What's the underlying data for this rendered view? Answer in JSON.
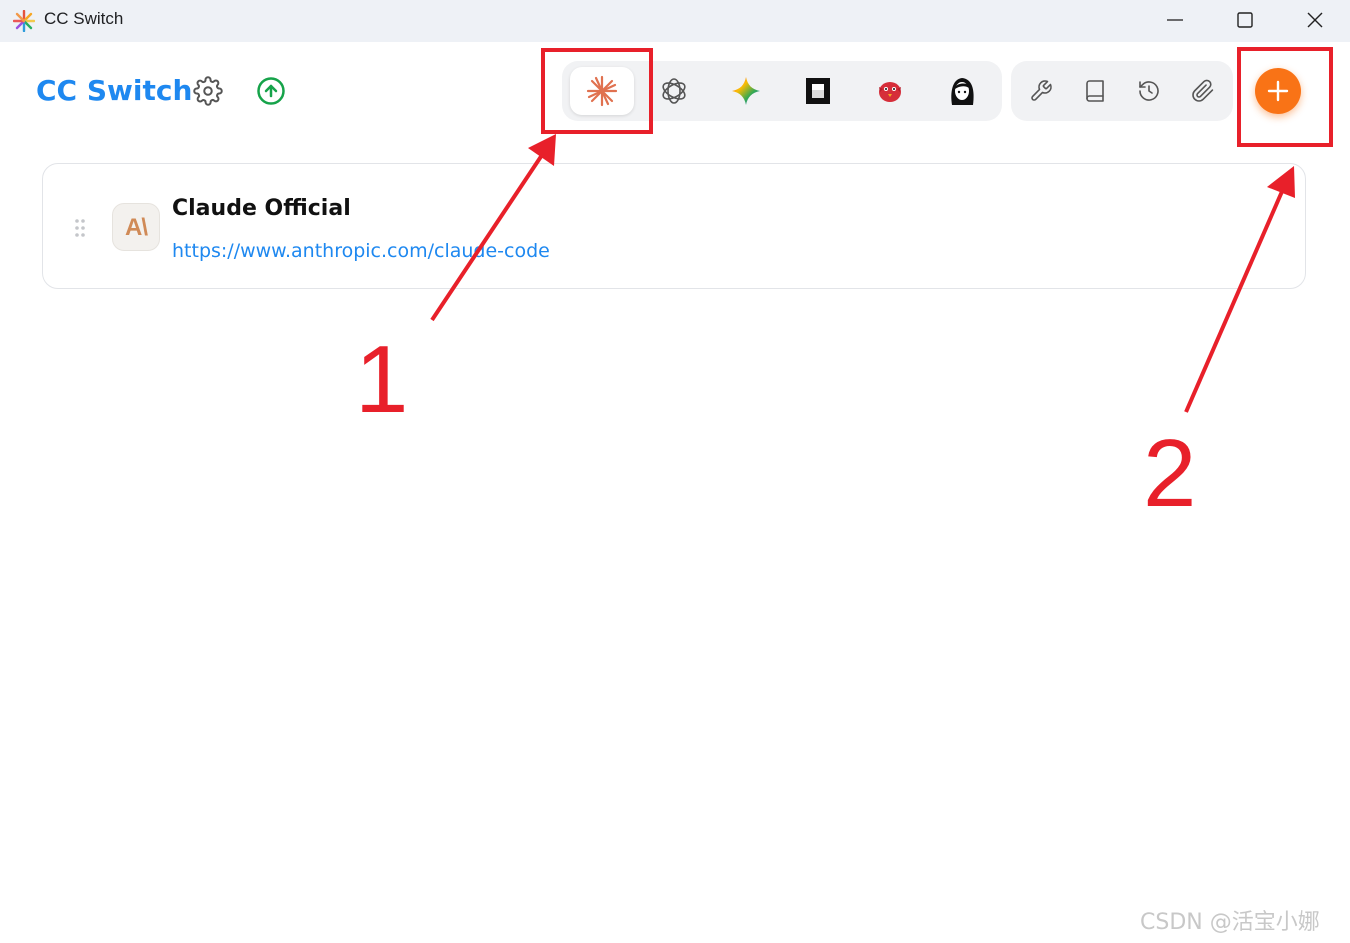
{
  "window": {
    "title": "CC Switch",
    "controls": [
      "minimize",
      "maximize",
      "close"
    ]
  },
  "header": {
    "brand": "CC Switch",
    "settings_icon": "gear-icon",
    "update_icon": "arrow-up-circle-icon",
    "apps": [
      {
        "id": "claude",
        "icon": "claude-starburst-icon",
        "active": true
      },
      {
        "id": "codex",
        "icon": "openai-icon",
        "active": false
      },
      {
        "id": "gemini",
        "icon": "gemini-sparkle-icon",
        "active": false
      },
      {
        "id": "app4",
        "icon": "black-square-icon",
        "active": false
      },
      {
        "id": "app5",
        "icon": "red-bird-icon",
        "active": false
      },
      {
        "id": "app6",
        "icon": "avatar-girl-icon",
        "active": false
      }
    ],
    "tools": [
      "wrench-icon",
      "book-icon",
      "history-icon",
      "paperclip-icon"
    ],
    "add_icon": "plus-icon"
  },
  "provider": {
    "logo_text": "A\\",
    "name": "Claude Official",
    "url": "https://www.anthropic.com/claude-code"
  },
  "annotations": {
    "label_1": "1",
    "label_2": "2",
    "color": "#e8202a"
  },
  "watermark": "CSDN @活宝小娜",
  "colors": {
    "brand": "#1e88f0",
    "accent": "#f97316",
    "update": "#16a34a"
  }
}
